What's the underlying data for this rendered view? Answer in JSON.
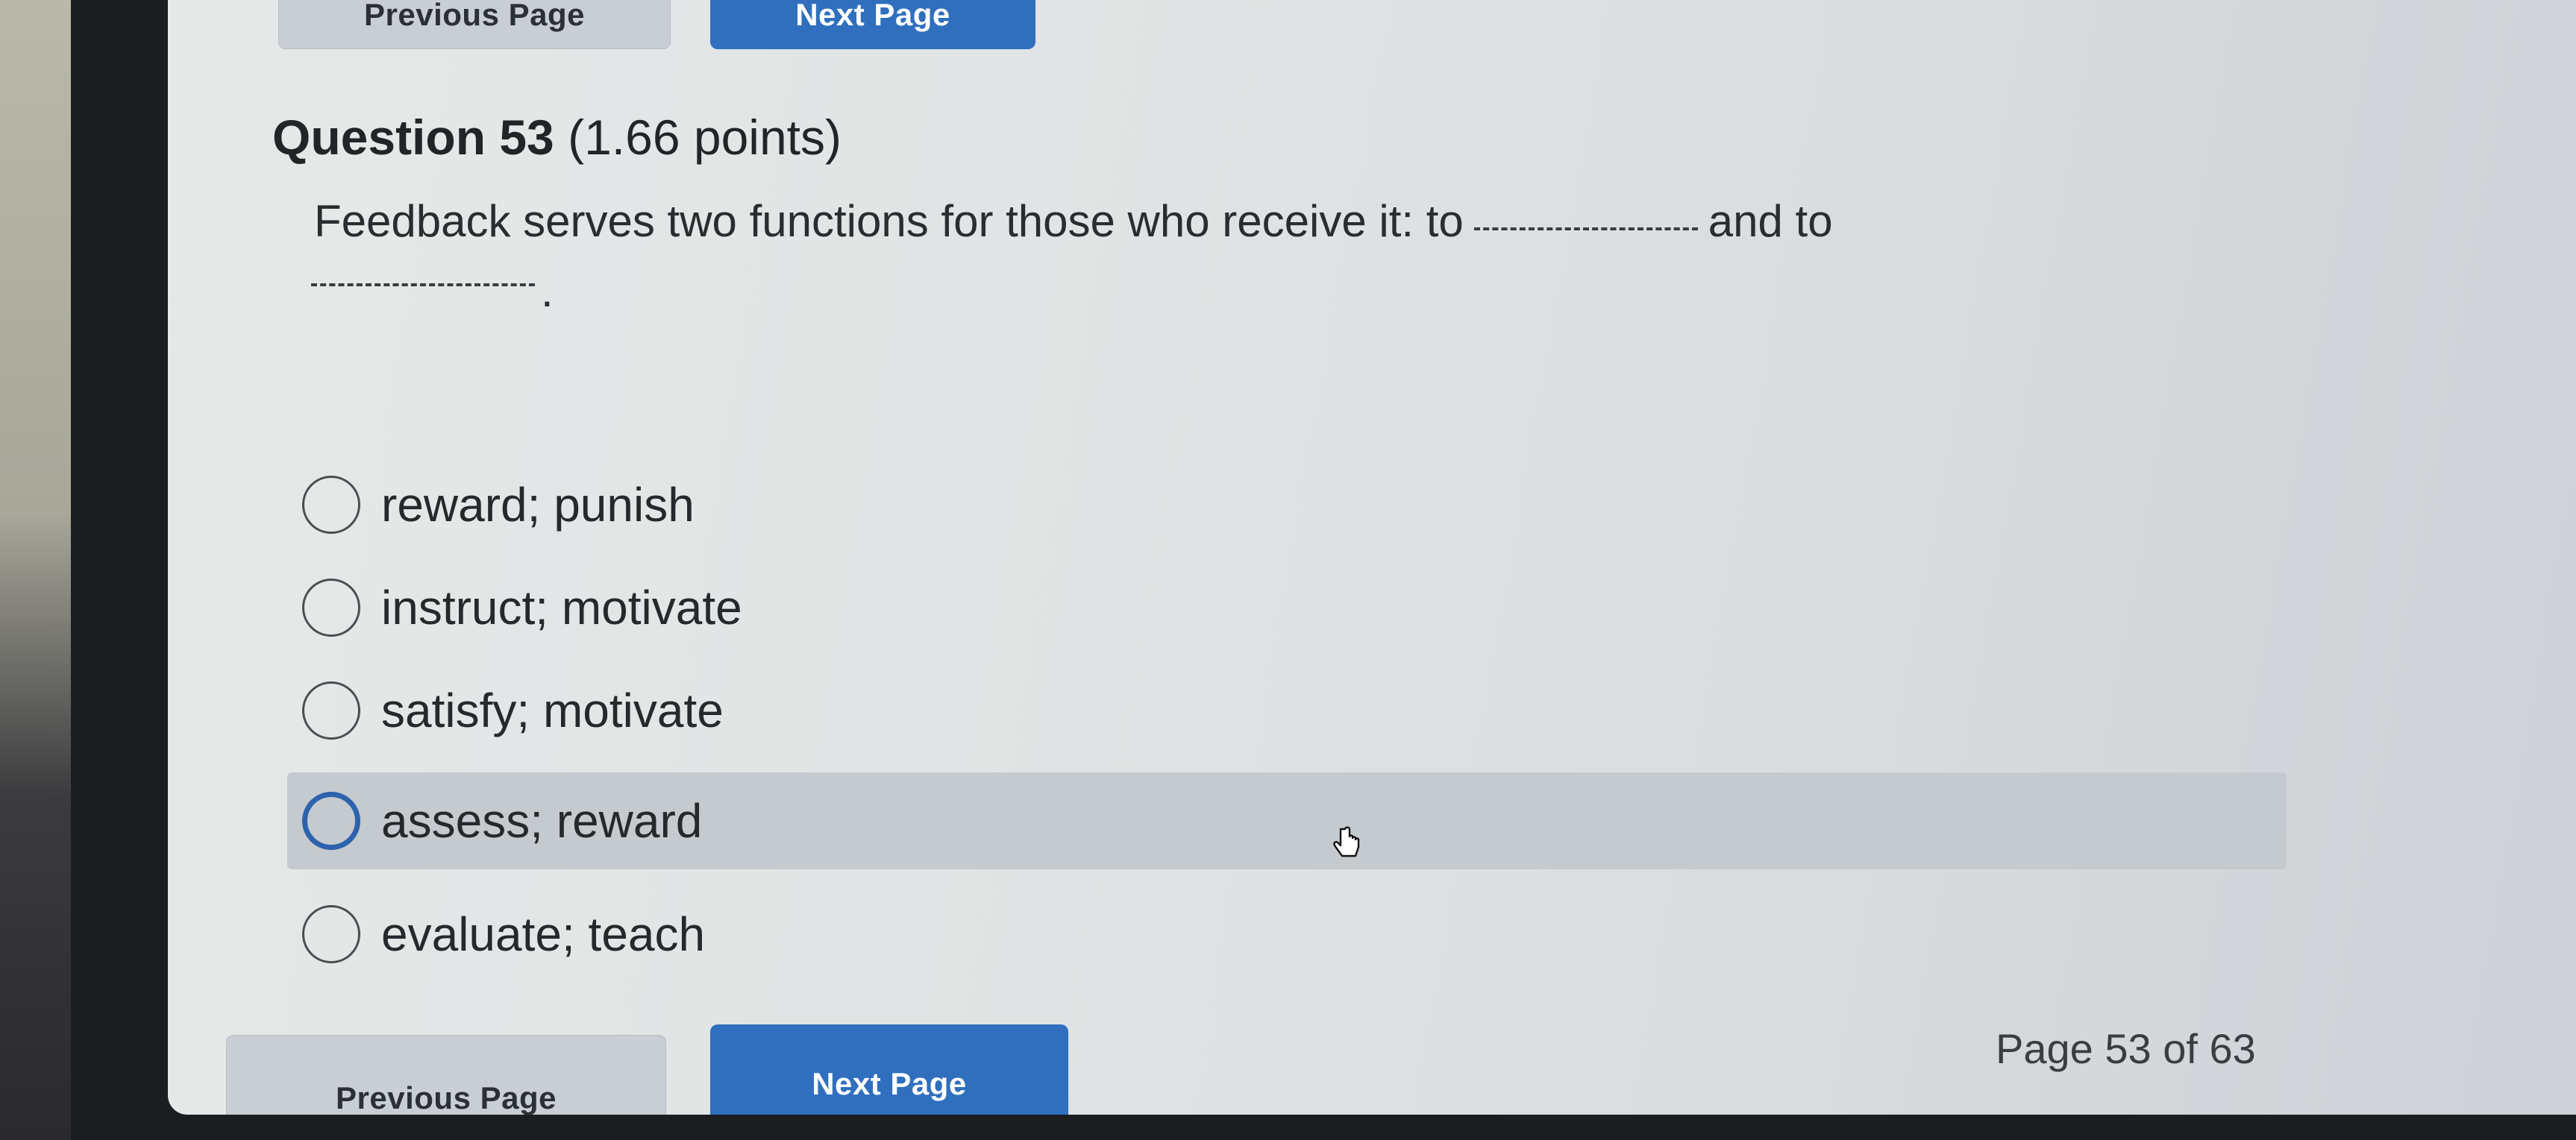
{
  "nav_top": {
    "prev_label": "Previous Page",
    "next_label": "Next Page"
  },
  "nav_bottom": {
    "prev_label": "Previous Page",
    "next_label": "Next Page",
    "page_indicator": "Page 53 of 63"
  },
  "question": {
    "number_label": "Question 53",
    "points_label": "(1.66 points)",
    "text_part1": "Feedback serves two functions for those who receive it: to",
    "text_part2": "and to",
    "text_end": "."
  },
  "options": [
    {
      "label": "reward; punish",
      "selected": false
    },
    {
      "label": "instruct; motivate",
      "selected": false
    },
    {
      "label": "satisfy; motivate",
      "selected": false
    },
    {
      "label": "assess; reward",
      "selected": false,
      "hovered": true
    },
    {
      "label": "evaluate; teach",
      "selected": false
    }
  ],
  "icons": {
    "cursor": "hand-pointer-icon",
    "radio": "radio-button-icon"
  },
  "colors": {
    "next_button": "#2f6fbe",
    "hover_row": "#c5cacf",
    "radio_focus": "#2d62ad"
  }
}
